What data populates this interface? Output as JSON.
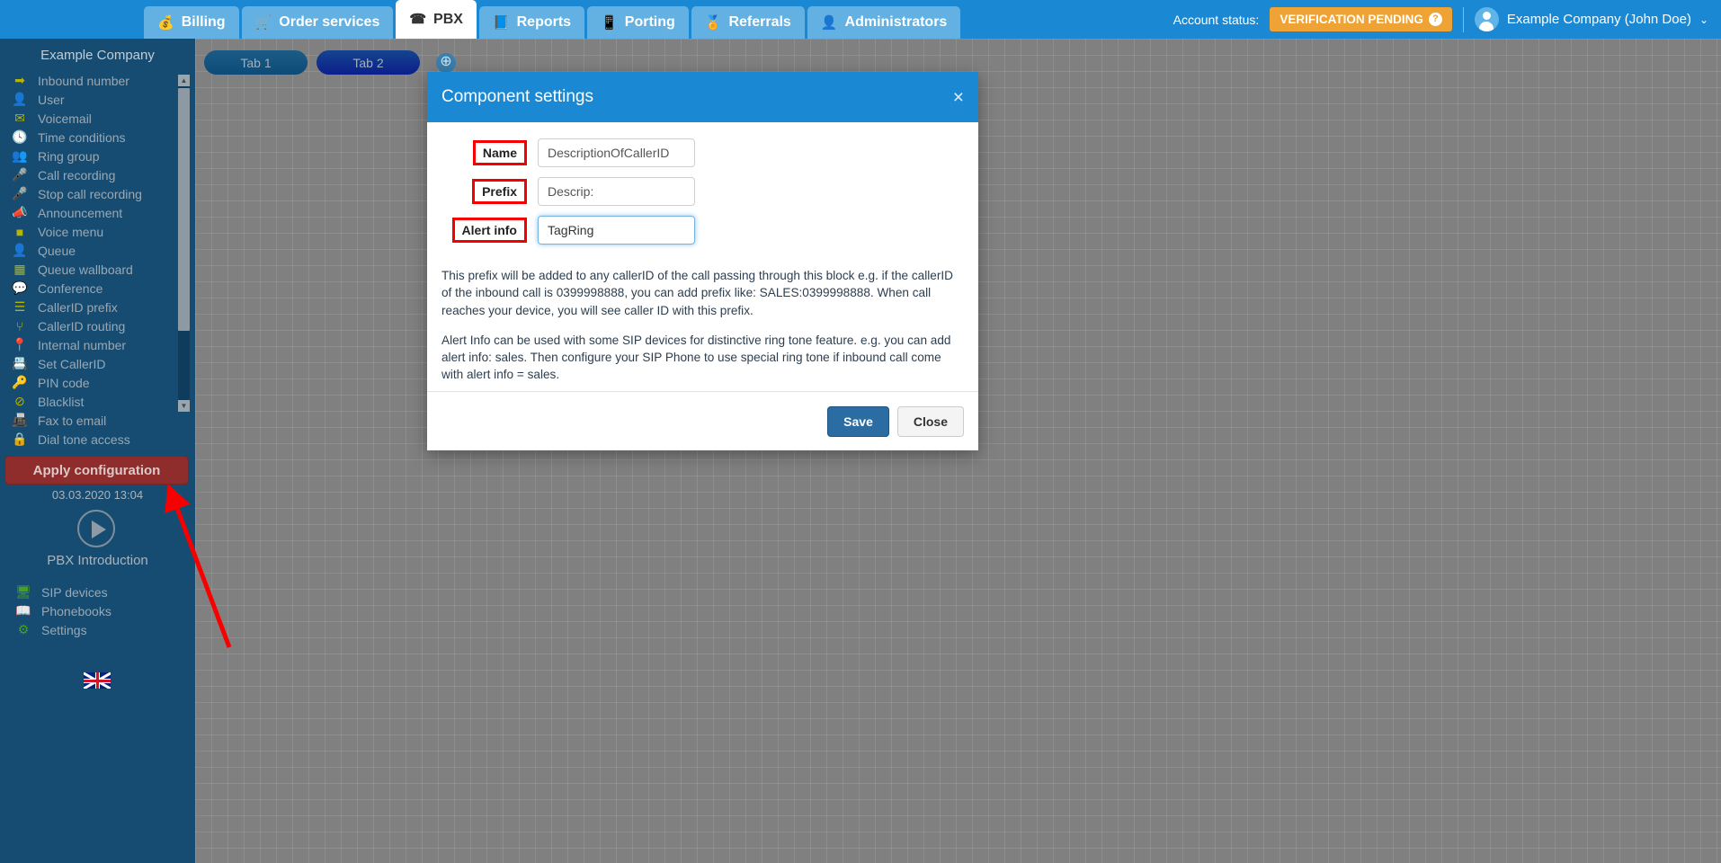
{
  "topnav": {
    "tabs": [
      {
        "label": "Billing",
        "icon": "coins-icon",
        "glyph": "💰",
        "active": false
      },
      {
        "label": "Order services",
        "icon": "cart-icon",
        "glyph": "🛒",
        "active": false
      },
      {
        "label": "PBX",
        "icon": "pbx-icon",
        "glyph": "☎",
        "active": true
      },
      {
        "label": "Reports",
        "icon": "reports-icon",
        "glyph": "📘",
        "active": false
      },
      {
        "label": "Porting",
        "icon": "porting-icon",
        "glyph": "📱",
        "active": false
      },
      {
        "label": "Referrals",
        "icon": "referrals-icon",
        "glyph": "🏅",
        "active": false
      },
      {
        "label": "Administrators",
        "icon": "admins-icon",
        "glyph": "👤",
        "active": false
      }
    ],
    "account_status_label": "Account status:",
    "verification_badge": "VERIFICATION PENDING",
    "verification_help_glyph": "?",
    "user_name": "Example Company (John Doe)",
    "user_caret": "⌄"
  },
  "sidebar": {
    "company": "Example Company",
    "items": [
      {
        "label": "Inbound number",
        "icon": "arrow-right-icon",
        "glyph": "➡"
      },
      {
        "label": "User",
        "icon": "user-icon",
        "glyph": "👤"
      },
      {
        "label": "Voicemail",
        "icon": "envelope-icon",
        "glyph": "✉"
      },
      {
        "label": "Time conditions",
        "icon": "clock-icon",
        "glyph": "🕓"
      },
      {
        "label": "Ring group",
        "icon": "users-group-icon",
        "glyph": "👥"
      },
      {
        "label": "Call recording",
        "icon": "microphone-icon",
        "glyph": "🎤"
      },
      {
        "label": "Stop call recording",
        "icon": "microphone-slash-icon",
        "glyph": "🎤"
      },
      {
        "label": "Announcement",
        "icon": "bullhorn-icon",
        "glyph": "📣"
      },
      {
        "label": "Voice menu",
        "icon": "grid-icon",
        "glyph": "■"
      },
      {
        "label": "Queue",
        "icon": "user-plus-icon",
        "glyph": "👤"
      },
      {
        "label": "Queue wallboard",
        "icon": "table-icon",
        "glyph": "▦"
      },
      {
        "label": "Conference",
        "icon": "comments-icon",
        "glyph": "💬"
      },
      {
        "label": "CallerID prefix",
        "icon": "list-icon",
        "glyph": "☰"
      },
      {
        "label": "CallerID routing",
        "icon": "sitemap-icon",
        "glyph": "⑂"
      },
      {
        "label": "Internal number",
        "icon": "map-pin-icon",
        "glyph": "📍"
      },
      {
        "label": "Set CallerID",
        "icon": "id-card-icon",
        "glyph": "📇"
      },
      {
        "label": "PIN code",
        "icon": "key-icon",
        "glyph": "🔑"
      },
      {
        "label": "Blacklist",
        "icon": "ban-icon",
        "glyph": "⊘"
      },
      {
        "label": "Fax to email",
        "icon": "fax-icon",
        "glyph": "📠"
      },
      {
        "label": "Dial tone access",
        "icon": "lock-icon",
        "glyph": "🔒"
      }
    ],
    "apply_button": "Apply configuration",
    "apply_timestamp": "03.03.2020 13:04",
    "intro_label": "PBX Introduction",
    "play_icon": "play-icon",
    "bottom_items": [
      {
        "label": "SIP devices",
        "icon": "monitor-icon",
        "glyph": "🖥"
      },
      {
        "label": "Phonebooks",
        "icon": "book-icon",
        "glyph": "📖"
      },
      {
        "label": "Settings",
        "icon": "gear-icon",
        "glyph": "⚙"
      }
    ],
    "language_flag": "uk-flag-icon",
    "scroll_up_glyph": "▲",
    "scroll_down_glyph": "▼"
  },
  "canvas": {
    "tabs": [
      {
        "label": "Tab 1"
      },
      {
        "label": "Tab 2"
      }
    ],
    "add_tab_glyph": "⊕"
  },
  "modal": {
    "title": "Component settings",
    "close_glyph": "×",
    "fields": [
      {
        "label": "Name",
        "value": "DescriptionOfCallerID",
        "placeholder": "",
        "focused": false
      },
      {
        "label": "Prefix",
        "value": "Descrip:",
        "placeholder": "",
        "focused": false
      },
      {
        "label": "Alert info",
        "value": "TagRing",
        "placeholder": "",
        "focused": true
      }
    ],
    "description_paragraphs": [
      "This prefix will be added to any callerID of the call passing through this block e.g. if the callerID of the inbound call is 0399998888, you can add prefix like: SALES:0399998888. When call reaches your device, you will see caller ID with this prefix.",
      "Alert Info can be used with some SIP devices for distinctive ring tone feature. e.g. you can add alert info: sales. Then configure your SIP Phone to use special ring tone if inbound call come with alert info = sales."
    ],
    "save_label": "Save",
    "close_label": "Close"
  },
  "annotation": {
    "arrow_color": "#f90000",
    "highlight_color": "#f40000"
  }
}
